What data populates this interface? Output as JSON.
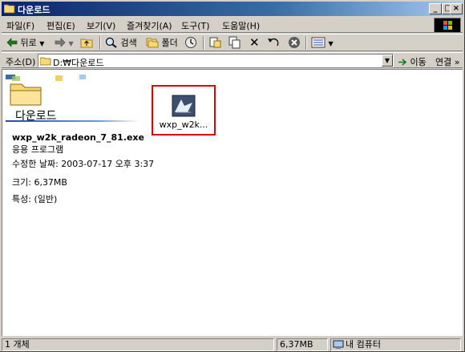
{
  "window": {
    "title": "다운로드",
    "buttons": {
      "minimize": "_",
      "maximize": "□",
      "close": "×"
    }
  },
  "menu": {
    "items": [
      "파일(F)",
      "편집(E)",
      "보기(V)",
      "즐겨찾기(A)",
      "도구(T)",
      "도움말(H)"
    ]
  },
  "toolbar": {
    "back": "뒤로",
    "search": "검색",
    "folders": "폴더",
    "icons": [
      "back-arrow-icon",
      "forward-arrow-icon",
      "up-folder-icon",
      "search-icon",
      "folders-icon",
      "history-icon",
      "move-to-icon",
      "copy-to-icon",
      "delete-icon",
      "undo-icon",
      "cancel-icon",
      "views-icon"
    ]
  },
  "address": {
    "label": "주소(D)",
    "value": "D:₩다운로드",
    "go": "이동",
    "links": "연결 »"
  },
  "panel": {
    "folder_name": "다운로드",
    "file_name": "wxp_w2k_radeon_7_81.exe",
    "file_type": "응용 프로그램",
    "modified": "수정한 날짜: 2003-07-17 오후 3:37",
    "size": "크기: 6,37MB",
    "attributes": "특성: (일반)"
  },
  "files": [
    {
      "label": "wxp_w2k...",
      "icon": "installer-icon",
      "selected": true
    }
  ],
  "status": {
    "objects": "1 개체",
    "size": "6,37MB",
    "location": "내 컴퓨터"
  },
  "colors": {
    "title_start": "#0a246a",
    "title_end": "#a6caf0",
    "window_bg": "#d4d0c8",
    "highlight_box": "#e00000"
  }
}
